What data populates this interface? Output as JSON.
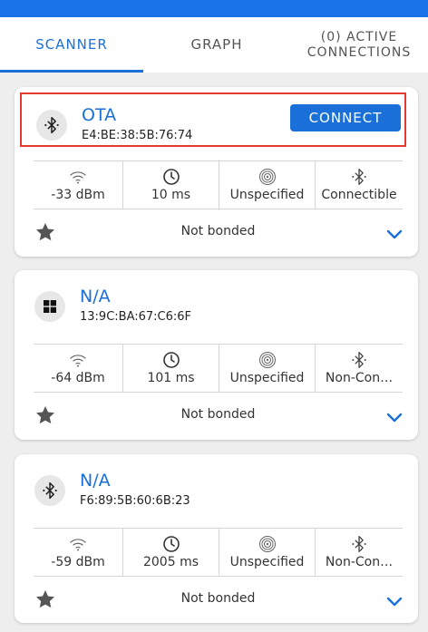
{
  "tabs": [
    {
      "label": "SCANNER"
    },
    {
      "label": "GRAPH"
    },
    {
      "label_line1": "(0) ACTIVE",
      "label_line2": "CONNECTIONS"
    }
  ],
  "accent_color": "#1a6fd8",
  "highlight_color": "#e23a2e",
  "devices": [
    {
      "name": "OTA",
      "address": "E4:BE:38:5B:76:74",
      "icon": "bluetooth-icon",
      "connect_label": "CONNECT",
      "rssi": "-33 dBm",
      "interval": "10 ms",
      "tx_power": "Unspecified",
      "connectable": "Connectible",
      "bond": "Not bonded"
    },
    {
      "name": "N/A",
      "address": "13:9C:BA:67:C6:6F",
      "icon": "windows-icon",
      "rssi": "-64 dBm",
      "interval": "101 ms",
      "tx_power": "Unspecified",
      "connectable": "Non-Con…",
      "bond": "Not bonded"
    },
    {
      "name": "N/A",
      "address": "F6:89:5B:60:6B:23",
      "icon": "bluetooth-icon",
      "rssi": "-59 dBm",
      "interval": "2005 ms",
      "tx_power": "Unspecified",
      "connectable": "Non-Con…",
      "bond": "Not bonded"
    }
  ]
}
